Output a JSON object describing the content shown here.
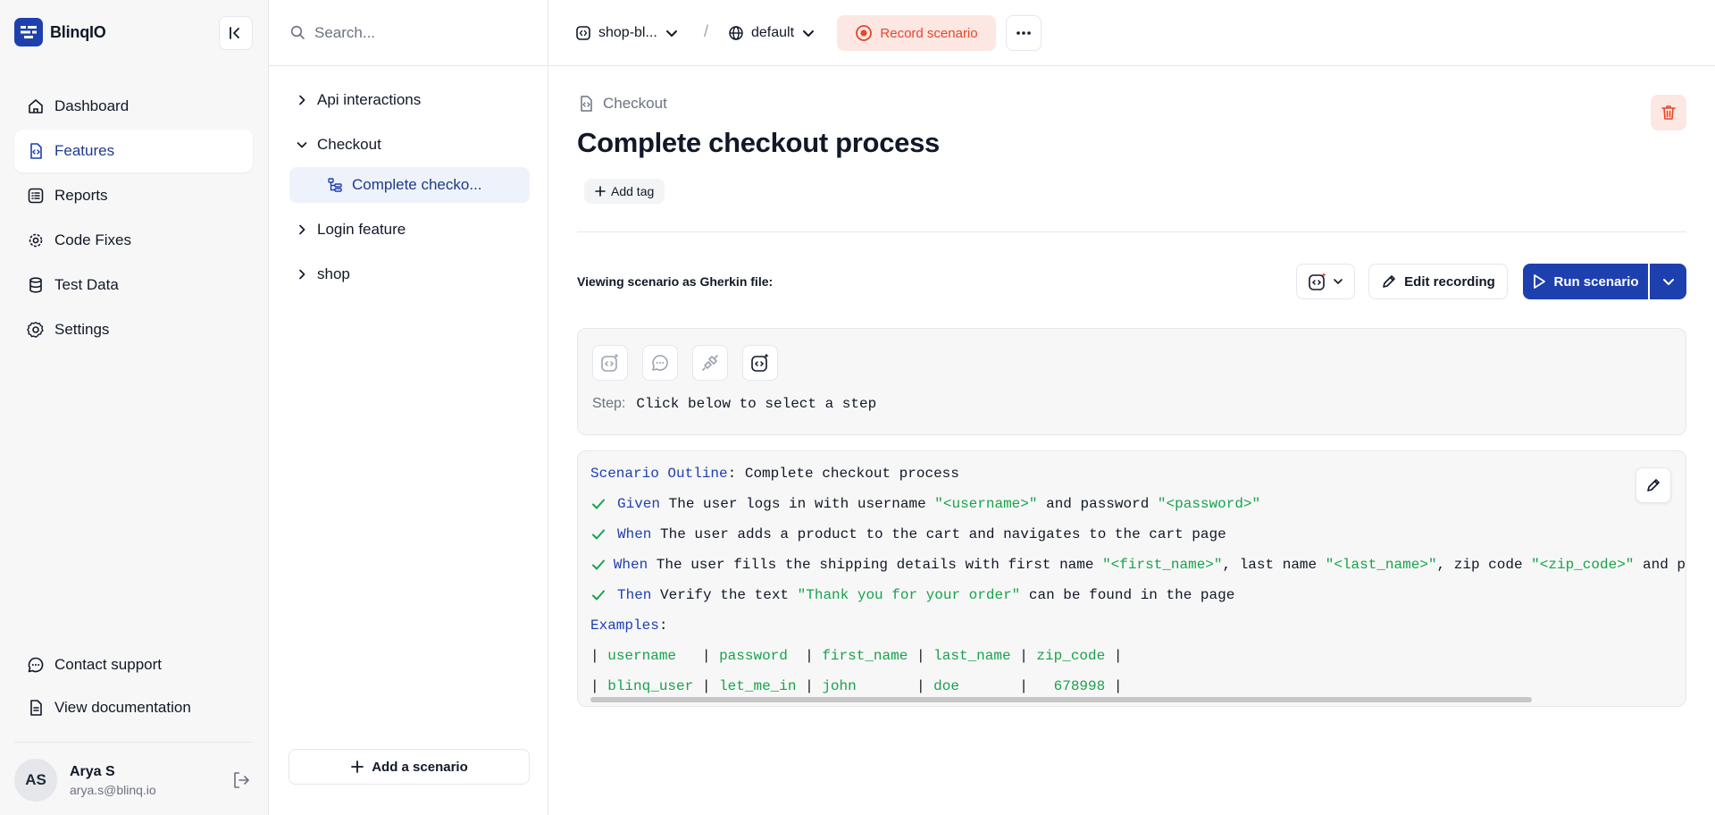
{
  "brand": {
    "name": "BlinqIO"
  },
  "sidebar": {
    "items": [
      {
        "label": "Dashboard",
        "icon": "home-icon",
        "active": false
      },
      {
        "label": "Features",
        "icon": "feature-file-icon",
        "active": true
      },
      {
        "label": "Reports",
        "icon": "list-icon",
        "active": false
      },
      {
        "label": "Code Fixes",
        "icon": "gear-cog-icon",
        "active": false
      },
      {
        "label": "Test Data",
        "icon": "database-icon",
        "active": false
      },
      {
        "label": "Settings",
        "icon": "settings-icon",
        "active": false
      }
    ],
    "bottom": [
      {
        "label": "Contact support",
        "icon": "chat-icon"
      },
      {
        "label": "View documentation",
        "icon": "document-icon"
      }
    ],
    "user": {
      "initials": "AS",
      "name": "Arya S",
      "email": "arya.s@blinq.io"
    }
  },
  "explorer": {
    "search_placeholder": "Search...",
    "tree": [
      {
        "label": "Api interactions",
        "expanded": false
      },
      {
        "label": "Checkout",
        "expanded": true,
        "children": [
          {
            "label": "Complete checko..."
          }
        ]
      },
      {
        "label": "Login feature",
        "expanded": false
      },
      {
        "label": "shop",
        "expanded": false
      }
    ],
    "add_scenario": "Add a scenario"
  },
  "topbar": {
    "project": "shop-bl...",
    "separator": "/",
    "environment": "default",
    "record": "Record scenario"
  },
  "main": {
    "breadcrumb": "Checkout",
    "title": "Complete checkout process",
    "add_tag": "Add tag",
    "viewing_label": "Viewing scenario as Gherkin file:",
    "edit_recording": "Edit recording",
    "run_scenario": "Run scenario",
    "step_label": "Step:",
    "step_text": "Click below to select a step"
  },
  "gherkin": {
    "outline_keyword": "Scenario Outline",
    "outline_colon": ":",
    "outline_name": " Complete checkout process",
    "steps": [
      {
        "keyword": "Given",
        "parts": [
          {
            "t": " The user logs in with username ",
            "s": false
          },
          {
            "t": "\"<username>\"",
            "s": true
          },
          {
            "t": " and password ",
            "s": false
          },
          {
            "t": "\"<password>\"",
            "s": true
          }
        ]
      },
      {
        "keyword": "When",
        "parts": [
          {
            "t": " The user adds a product to the cart and navigates to the cart page",
            "s": false
          }
        ]
      },
      {
        "keyword": "When",
        "parts": [
          {
            "t": " The user fills the shipping details with first name ",
            "s": false
          },
          {
            "t": "\"<first_name>\"",
            "s": true
          },
          {
            "t": ", last name ",
            "s": false
          },
          {
            "t": "\"<last_name>\"",
            "s": true
          },
          {
            "t": ", zip code ",
            "s": false
          },
          {
            "t": "\"<zip_code>\"",
            "s": true
          },
          {
            "t": " and p",
            "s": false
          }
        ]
      },
      {
        "keyword": "Then",
        "parts": [
          {
            "t": " Verify the text ",
            "s": false
          },
          {
            "t": "\"Thank you for your order\"",
            "s": true
          },
          {
            "t": " can be found in the page",
            "s": false
          }
        ]
      }
    ],
    "examples_keyword": "Examples",
    "examples_colon": ":",
    "table": {
      "headers": [
        "username  ",
        "password ",
        "first_name",
        "last_name",
        "zip_code"
      ],
      "rows": [
        [
          "blinq_user",
          "let_me_in",
          "john      ",
          "doe      ",
          "  678998"
        ]
      ]
    }
  },
  "colors": {
    "accent": "#1e40af",
    "record": "#e5462a",
    "string": "#16a34a",
    "check": "#16a34a"
  }
}
